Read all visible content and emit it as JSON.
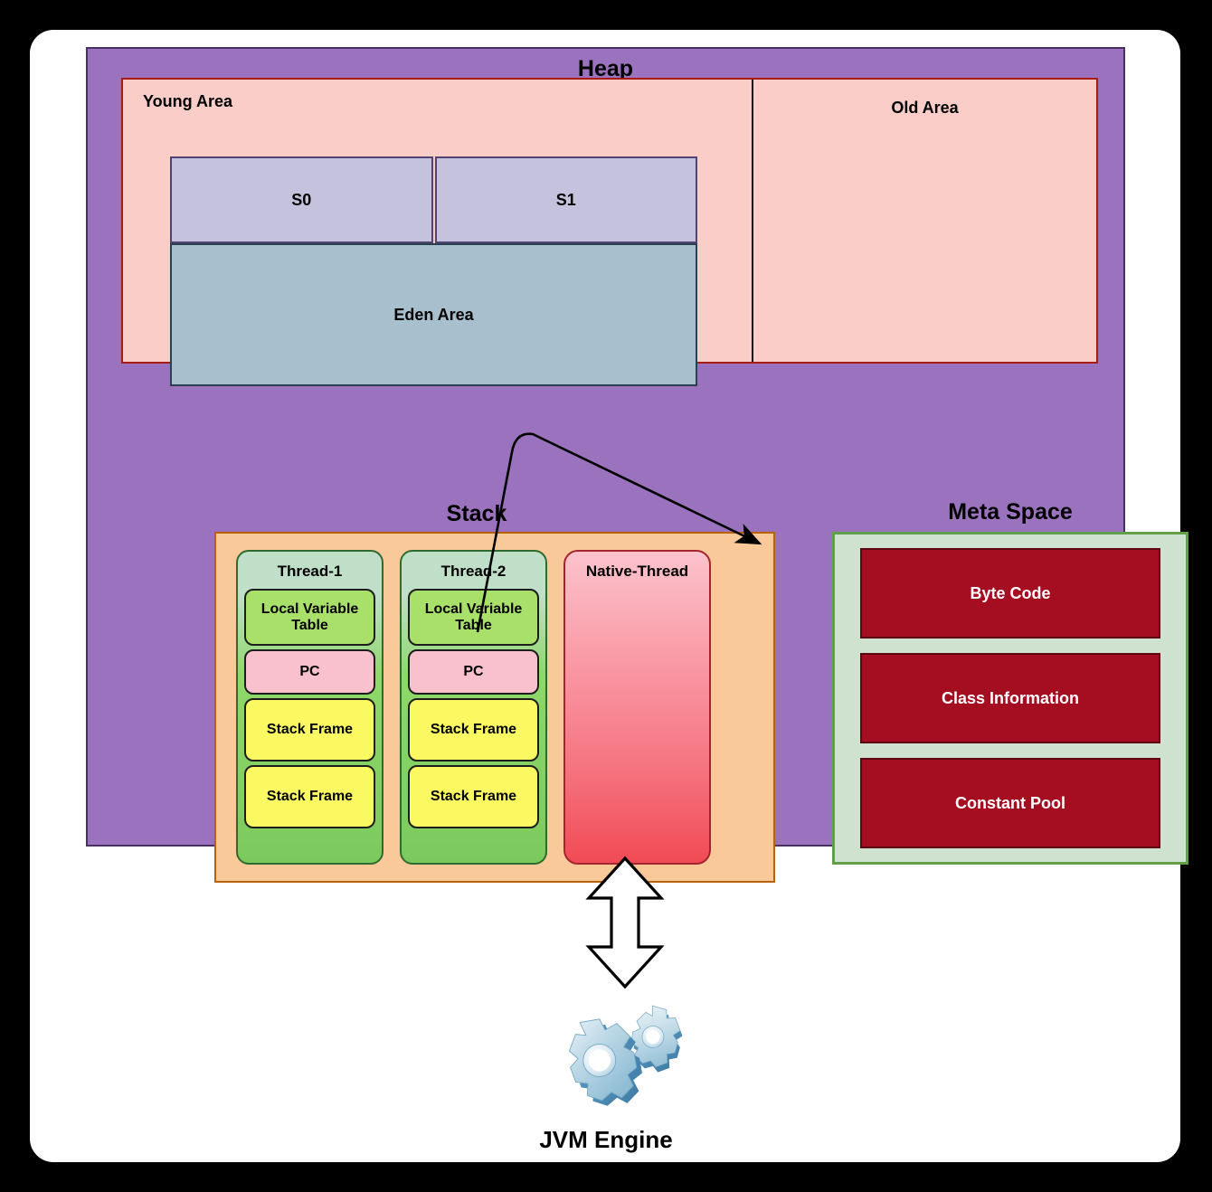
{
  "diagram": {
    "heap": {
      "title": "Heap",
      "young_area_label": "Young Area",
      "old_area_label": "Old Area",
      "survivors": [
        {
          "label": "S0"
        },
        {
          "label": "S1"
        }
      ],
      "eden_label": "Eden Area"
    },
    "stack": {
      "title": "Stack",
      "threads": [
        {
          "name": "Thread-1",
          "cells": [
            {
              "label": "Local Variable Table",
              "kind": "lvt"
            },
            {
              "label": "PC",
              "kind": "pc"
            },
            {
              "label": "Stack Frame",
              "kind": "sf"
            },
            {
              "label": "Stack Frame",
              "kind": "sf"
            }
          ]
        },
        {
          "name": "Thread-2",
          "cells": [
            {
              "label": "Local Variable Table",
              "kind": "lvt"
            },
            {
              "label": "PC",
              "kind": "pc"
            },
            {
              "label": "Stack Frame",
              "kind": "sf"
            },
            {
              "label": "Stack Frame",
              "kind": "sf"
            }
          ]
        }
      ],
      "native_thread_label": "Native-Thread"
    },
    "meta_space": {
      "title": "Meta Space",
      "items": [
        {
          "label": "Byte Code"
        },
        {
          "label": "Class Information"
        },
        {
          "label": "Constant Pool"
        }
      ]
    },
    "engine": {
      "label": "JVM Engine",
      "icon": "gears-icon",
      "link_icon": "double-headed-vertical-arrow-icon"
    },
    "connector": {
      "from": "Thread-2 PC",
      "to": "Byte Code",
      "icon": "curved-arrow-icon"
    },
    "colors": {
      "container_purple": "#9b72be",
      "heap_pink": "#fbcdc8",
      "heap_border_red": "#a61c14",
      "survivor_lavender": "#c5c2de",
      "eden_blue_gray": "#a8c0ce",
      "stack_orange": "#fac99a",
      "stack_border_orange": "#b8620b",
      "thread_green": "#8fd86a",
      "lvt_green": "#a8e06a",
      "pc_pink": "#f9c0cd",
      "stack_frame_yellow": "#fbf961",
      "native_thread_red": "#f14b55",
      "meta_green_fill": "#cfe2cf",
      "meta_green_border": "#61a04a",
      "meta_item_crimson": "#a50d21",
      "page_white": "#ffffff",
      "background_black": "#000000"
    }
  }
}
